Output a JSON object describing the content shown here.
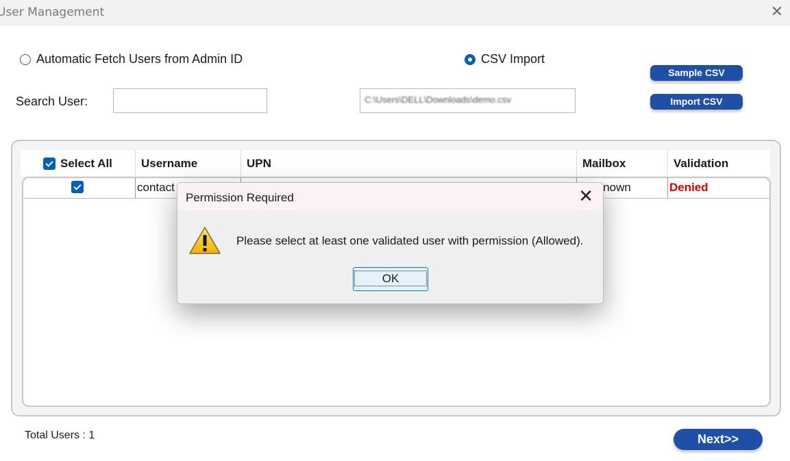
{
  "window": {
    "title": "User Management",
    "close_glyph": "✕"
  },
  "mode": {
    "auto_fetch_label": "Automatic Fetch Users from Admin ID",
    "csv_import_label": "CSV Import",
    "selected": "csv_import"
  },
  "search": {
    "label": "Search User:",
    "value": ""
  },
  "csv": {
    "path": "C:\\Users\\DELL\\Downloads\\demo.csv",
    "sample_button": "Sample CSV",
    "import_button": "Import CSV"
  },
  "table": {
    "select_all_label": "Select All",
    "columns": [
      "Username",
      "UPN",
      "Mailbox",
      "Validation"
    ],
    "rows": [
      {
        "selected": true,
        "username": "contact",
        "upn": "",
        "mailbox": "Unknown",
        "validation": "Denied"
      }
    ]
  },
  "footer": {
    "total_users": "Total Users : 1",
    "next_button": "Next>>"
  },
  "dialog": {
    "title": "Permission Required",
    "message": "Please select at least one validated user with permission (Allowed).",
    "ok_button": "OK",
    "close_glyph": "✕",
    "icon": "warning-icon"
  },
  "colors": {
    "accent": "#1f4fa6",
    "denied": "#d40000",
    "checkbox": "#005fb8"
  }
}
